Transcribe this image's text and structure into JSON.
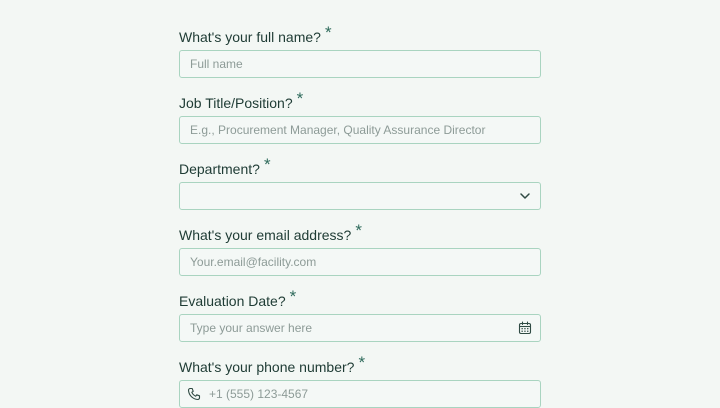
{
  "form": {
    "full_name": {
      "label": "What's your full name?",
      "required_mark": "*",
      "placeholder": "Full name"
    },
    "job_title": {
      "label": "Job Title/Position?",
      "required_mark": "*",
      "placeholder": "E.g., Procurement Manager, Quality Assurance Director"
    },
    "department": {
      "label": "Department?",
      "required_mark": "*",
      "selected_value": ""
    },
    "email": {
      "label": "What's your email address?",
      "required_mark": "*",
      "placeholder": "Your.email@facility.com"
    },
    "evaluation_date": {
      "label": "Evaluation Date?",
      "required_mark": "*",
      "placeholder": "Type your answer here"
    },
    "phone": {
      "label": "What's your phone number?",
      "required_mark": "*",
      "placeholder": "+1 (555) 123-4567"
    }
  },
  "icons": {
    "department_dropdown": "chevron-down-icon",
    "evaluation_date": "calendar-icon",
    "phone": "phone-icon"
  },
  "colors": {
    "background": "#f3f7f4",
    "label_text": "#1e3b34",
    "required_mark": "#2f6b5c",
    "input_border": "#a9d4c0",
    "placeholder": "#8d9b97"
  }
}
